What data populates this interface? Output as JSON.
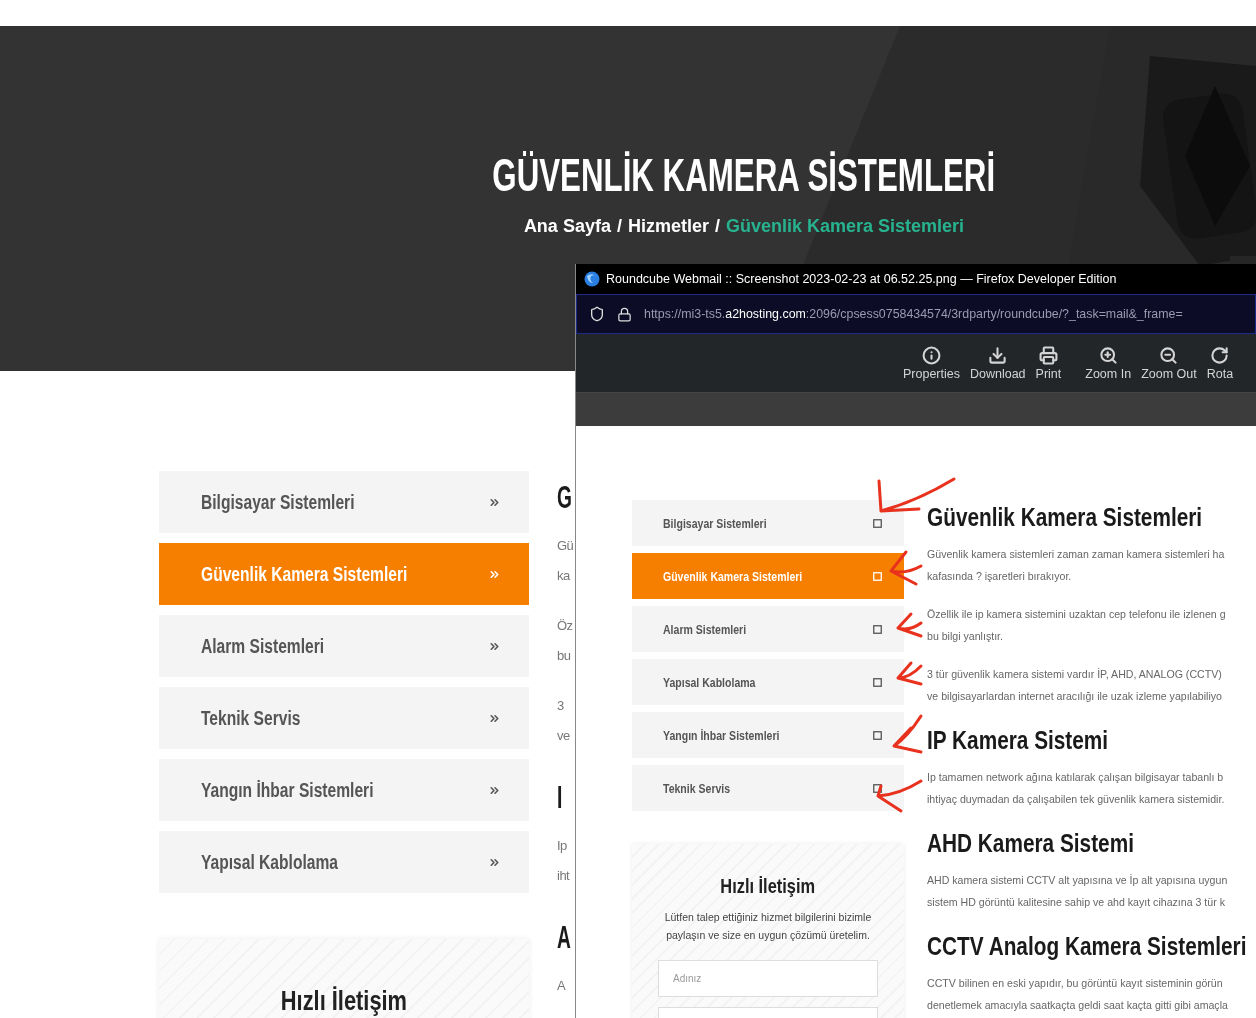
{
  "hero": {
    "title": "GÜVENLİK KAMERA SİSTEMLERİ",
    "breadcrumb": [
      {
        "label": "Ana Sayfa",
        "current": false
      },
      {
        "label": "Hizmetler",
        "current": false
      },
      {
        "label": "Güvenlik Kamera Sistemleri",
        "current": true
      }
    ],
    "separators": [
      "/",
      "/"
    ]
  },
  "sidebar": {
    "items": [
      {
        "label": "Bilgisayar Sistemleri",
        "selected": false
      },
      {
        "label": "Güvenlik Kamera Sistemleri",
        "selected": true
      },
      {
        "label": "Alarm Sistemleri",
        "selected": false
      },
      {
        "label": "Teknik Servis",
        "selected": false
      },
      {
        "label": "Yangın İhbar Sistemleri",
        "selected": false
      },
      {
        "label": "Yapısal Kablolama",
        "selected": false
      }
    ]
  },
  "content_fragments": [
    {
      "kind": "heading",
      "text": "G"
    },
    {
      "kind": "paragraph",
      "lines": [
        "Gü",
        "ka"
      ]
    },
    {
      "kind": "paragraph",
      "lines": [
        "Öz",
        "bu"
      ]
    },
    {
      "kind": "paragraph",
      "lines": [
        "3",
        "ve"
      ]
    },
    {
      "kind": "heading",
      "text": "I"
    },
    {
      "kind": "paragraph",
      "lines": [
        "Ip",
        "iht"
      ]
    },
    {
      "kind": "heading",
      "text": "A"
    },
    {
      "kind": "paragraph",
      "lines": [
        "A"
      ]
    }
  ],
  "quick_contact": {
    "title": "Hızlı İletişim"
  },
  "overlay_window": {
    "title": "Roundcube Webmail :: Screenshot 2023-02-23 at 06.52.25.png — Firefox Developer Edition",
    "url": {
      "prefix": "https://mi3-ts5.",
      "domain": "a2hosting.com",
      "suffix": ":2096/cpsess0758434574/3rdparty/roundcube/?_task=mail&_frame="
    },
    "toolbar": [
      {
        "kind": "info",
        "label": "Properties"
      },
      {
        "kind": "download",
        "label": "Download"
      },
      {
        "kind": "print",
        "label": "Print"
      },
      {
        "kind": "zoom_in",
        "label": "Zoom In"
      },
      {
        "kind": "zoom_out",
        "label": "Zoom Out"
      },
      {
        "kind": "rotate",
        "label": "Rota"
      }
    ],
    "page": {
      "sidebar": [
        {
          "label": "Bilgisayar Sistemleri",
          "selected": false
        },
        {
          "label": "Güvenlik Kamera Sistemleri",
          "selected": true
        },
        {
          "label": "Alarm Sistemleri",
          "selected": false
        },
        {
          "label": "Yapısal Kablolama",
          "selected": false
        },
        {
          "label": "Yangın İhbar Sistemleri",
          "selected": false
        },
        {
          "label": "Teknik Servis",
          "selected": false
        }
      ],
      "sections": [
        {
          "heading": "Güvenlik Kamera Sistemleri",
          "paragraphs": [
            [
              "Güvenlik kamera sistemleri zaman zaman kamera sistemleri ha",
              "kafasında ? işaretleri bırakıyor."
            ],
            [
              "Özellik ile ip kamera sistemini uzaktan cep telefonu ile izlenen g",
              "bu bilgi yanlıştır."
            ],
            [
              "3 tür güvenlik kamera sistemi vardır İP, AHD, ANALOG (CCTV)",
              "ve bilgisayarlardan internet aracılığı ile uzak izleme yapılabiliyo"
            ]
          ]
        },
        {
          "heading": "IP Kamera Sistemi",
          "paragraphs": [
            [
              "Ip tamamen network ağına katılarak çalışan bilgisayar tabanlı b",
              "ihtiyaç duymadan da çalışabilen tek güvenlik kamera sistemidir."
            ]
          ]
        },
        {
          "heading": "AHD Kamera Sistemi",
          "paragraphs": [
            [
              "AHD kamera sistemi CCTV alt yapısına ve İp alt yapısına uygun",
              "sistem HD görüntü kalitesine sahip ve ahd kayıt cihazına 3 tür k"
            ]
          ]
        },
        {
          "heading": "CCTV Analog Kamera Sistemleri",
          "paragraphs": [
            [
              "CCTV bilinen en eski yapıdır, bu görüntü kayıt sisteminin görün",
              "denetlemek amacıyla saatkaçta geldi saat kaçta gitti gibi amaçla"
            ]
          ]
        }
      ],
      "quick_contact": {
        "title": "Hızlı İletişim",
        "text": "Lütfen talep ettiğiniz hizmet bilgilerini bizimle paylaşın ve size en uygun çözümü üretelim.",
        "fields": [
          {
            "kind": "input",
            "placeholder": "Adınız"
          },
          {
            "kind": "input"
          }
        ]
      }
    }
  }
}
